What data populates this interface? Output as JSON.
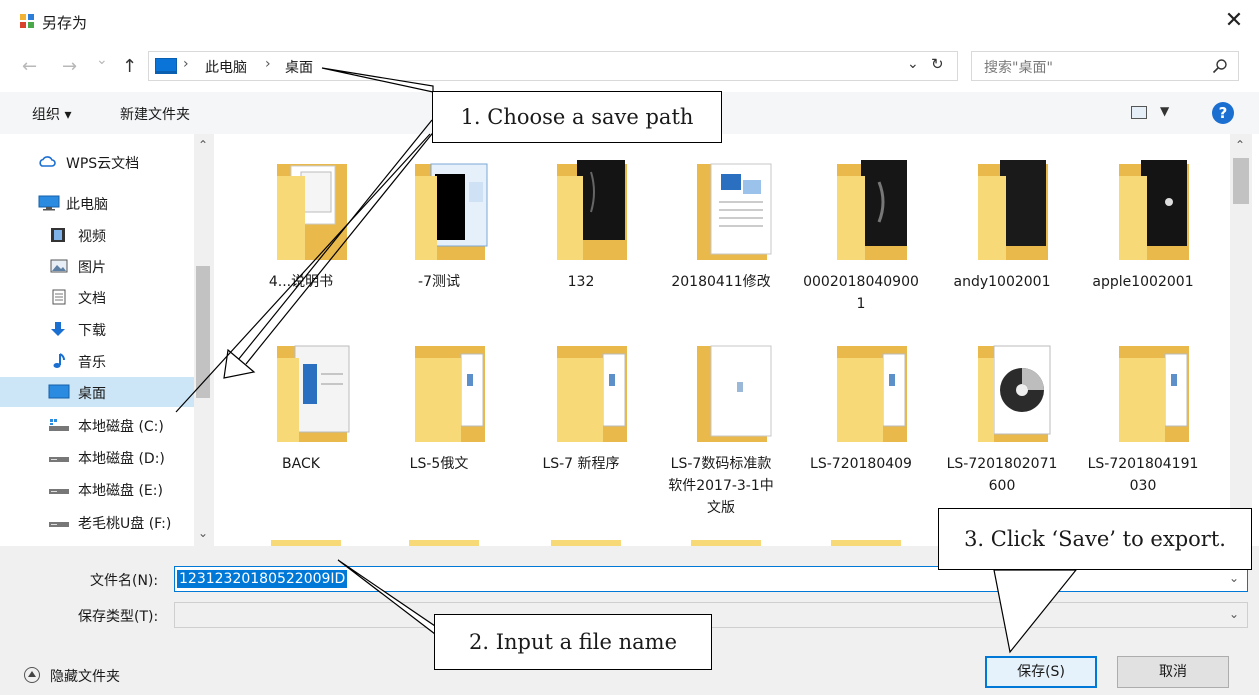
{
  "window": {
    "title": "另存为",
    "close_glyph": "✕"
  },
  "nav": {
    "back_glyph": "←",
    "forward_glyph": "→",
    "history_glyph": "⌄",
    "up_glyph": "↑",
    "breadcrumb": [
      "此电脑",
      "桌面"
    ],
    "separator": "›",
    "dropdown_glyph": "⌄",
    "refresh_glyph": "↻",
    "search_placeholder": "搜索\"桌面\""
  },
  "toolbar": {
    "organize": "组织 ▾",
    "new_folder": "新建文件夹",
    "view_dropdown": "▼",
    "help": "?"
  },
  "sidebar": {
    "items": [
      {
        "label": "WPS云文档",
        "icon": "cloud-icon"
      },
      {
        "label": "此电脑",
        "icon": "computer-icon"
      },
      {
        "label": "视频",
        "icon": "video-icon"
      },
      {
        "label": "图片",
        "icon": "pictures-icon"
      },
      {
        "label": "文档",
        "icon": "documents-icon"
      },
      {
        "label": "下载",
        "icon": "download-icon"
      },
      {
        "label": "音乐",
        "icon": "music-icon"
      },
      {
        "label": "桌面",
        "icon": "desktop-icon",
        "selected": true
      },
      {
        "label": "本地磁盘 (C:)",
        "icon": "system-drive-icon"
      },
      {
        "label": "本地磁盘 (D:)",
        "icon": "drive-icon"
      },
      {
        "label": "本地磁盘 (E:)",
        "icon": "drive-icon"
      },
      {
        "label": "老毛桃U盘 (F:)",
        "icon": "usb-drive-icon"
      }
    ],
    "scroll_up": "⌃",
    "scroll_down": "⌄"
  },
  "files": {
    "row1": [
      {
        "name": "4...说明书",
        "thumb": "docs"
      },
      {
        "name": "-7测试",
        "thumb": "screens"
      },
      {
        "name": "132",
        "thumb": "dark"
      },
      {
        "name": "20180411修改",
        "thumb": "word"
      },
      {
        "name": "0002018040900\n1",
        "thumb": "dark"
      },
      {
        "name": "andy1002001",
        "thumb": "dark"
      },
      {
        "name": "apple1002001",
        "thumb": "dark"
      }
    ],
    "row2": [
      {
        "name": "BACK",
        "thumb": "blue-doc"
      },
      {
        "name": "LS-5俄文",
        "thumb": "strip"
      },
      {
        "name": "LS-7 新程序",
        "thumb": "strip"
      },
      {
        "name": "LS-7数码标准款\n软件2017-3-1中\n文版",
        "thumb": "white-doc"
      },
      {
        "name": "LS-720180409",
        "thumb": "strip"
      },
      {
        "name": "LS-7201802071\n600",
        "thumb": "disc"
      },
      {
        "name": "LS-7201804191\n030",
        "thumb": "strip"
      }
    ],
    "scroll_up": "⌃"
  },
  "form": {
    "filename_label": "文件名(N):",
    "filename_value": "12312320180522009ID",
    "filetype_label": "保存类型(T):",
    "filetype_value": "",
    "dropdown_glyph": "⌄",
    "hide_folders": "隐藏文件夹",
    "save_button": "保存(S)",
    "cancel_button": "取消"
  },
  "callouts": [
    {
      "text": "1.  Choose a save path"
    },
    {
      "text": "2.  Input a file name"
    },
    {
      "text": "3.  Click ‘Save’ to export."
    }
  ],
  "colors": {
    "accent": "#0078d7",
    "selection": "#cde6f7",
    "folder": "#f7d977",
    "folder_back": "#e9b94c"
  }
}
